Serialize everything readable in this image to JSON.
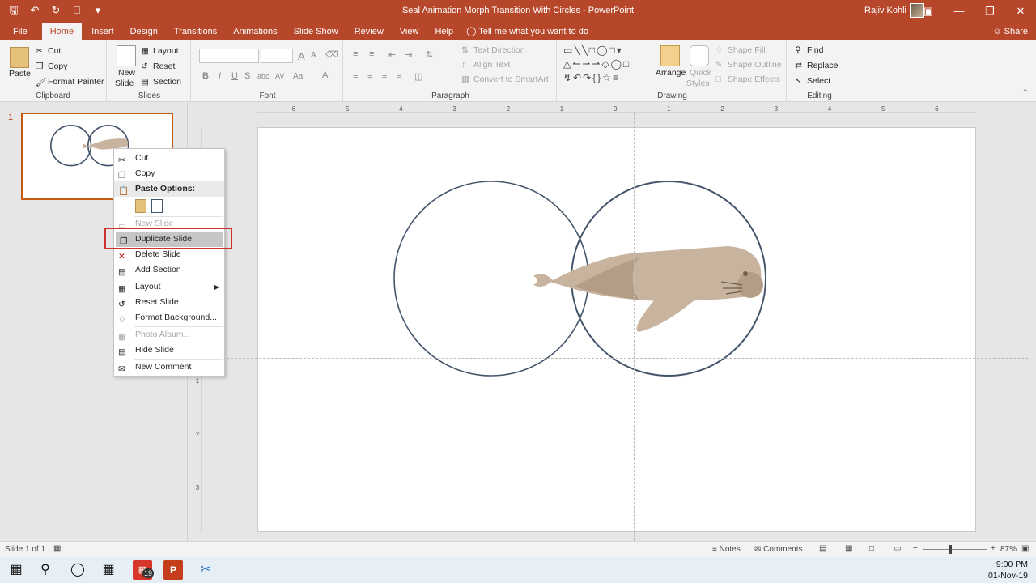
{
  "window": {
    "title": "Seal Animation Morph Transition With Circles  -  PowerPoint",
    "user": "Rajiv Kohli",
    "accent": "#b7472a"
  },
  "qat": [
    "save-icon",
    "undo-icon",
    "redo-icon",
    "start-from-beginning-icon",
    "customize-icon"
  ],
  "tabs": [
    "File",
    "Home",
    "Insert",
    "Design",
    "Transitions",
    "Animations",
    "Slide Show",
    "Review",
    "View",
    "Help"
  ],
  "tellme": "Tell me what you want to do",
  "share": "Share",
  "ribbon": {
    "clipboard": {
      "paste": "Paste",
      "cut": "Cut",
      "copy": "Copy",
      "format_painter": "Format Painter",
      "label": "Clipboard"
    },
    "slides": {
      "new_slide_1": "New",
      "new_slide_2": "Slide",
      "layout": "Layout",
      "reset": "Reset",
      "section": "Section",
      "label": "Slides"
    },
    "font": {
      "label": "Font",
      "bold": "B",
      "italic": "I",
      "underline": "U",
      "strike": "S",
      "shadow": "abc",
      "spacing": "AV",
      "case": "Aa",
      "grow": "A",
      "shrink": "A",
      "color": "A"
    },
    "paragraph": {
      "text_direction": "Text Direction",
      "align_text": "Align Text",
      "smartart": "Convert to SmartArt",
      "label": "Paragraph"
    },
    "drawing": {
      "arrange": "Arrange",
      "quick_styles_1": "Quick",
      "quick_styles_2": "Styles",
      "shape_fill": "Shape Fill",
      "shape_outline": "Shape Outline",
      "shape_effects": "Shape Effects",
      "label": "Drawing"
    },
    "editing": {
      "find": "Find",
      "replace": "Replace",
      "select": "Select",
      "label": "Editing"
    }
  },
  "thumbnail": {
    "number": "1"
  },
  "ruler": {
    "h": [
      "6",
      "5",
      "4",
      "3",
      "2",
      "1",
      "0",
      "1",
      "2",
      "3",
      "4",
      "5",
      "6"
    ],
    "v": [
      "1",
      "2",
      "3"
    ]
  },
  "context_menu": {
    "cut": "Cut",
    "copy": "Copy",
    "paste_options": "Paste Options:",
    "new_slide": "New Slide",
    "duplicate_slide": "Duplicate Slide",
    "delete_slide": "Delete Slide",
    "add_section": "Add Section",
    "layout": "Layout",
    "reset_slide": "Reset Slide",
    "format_background": "Format Background...",
    "photo_album": "Photo Album...",
    "hide_slide": "Hide Slide",
    "new_comment": "New Comment"
  },
  "status": {
    "slide_count": "Slide 1 of 1",
    "notes": "Notes",
    "comments": "Comments",
    "zoom": "87%"
  },
  "taskbar": {
    "time": "9:00 PM",
    "date": "01-Nov-19",
    "badge": "19"
  },
  "colors": {
    "circle": "#44546a",
    "seal": "#c8b49e",
    "seal_dark": "#b39d86",
    "highlight_box": "#d0312d"
  }
}
